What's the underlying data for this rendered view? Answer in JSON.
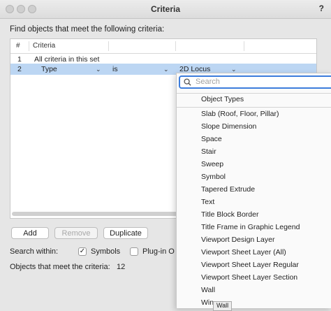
{
  "window": {
    "title": "Criteria",
    "help": "?"
  },
  "prompt": "Find objects that meet the following criteria:",
  "table": {
    "columns": [
      "#",
      "Criteria"
    ],
    "rows": [
      {
        "num": "1",
        "criteria": "All criteria in this set"
      },
      {
        "num": "2",
        "field": "Type",
        "operator": "is",
        "value": "2D Locus"
      }
    ]
  },
  "buttons": {
    "add": "Add",
    "remove": "Remove",
    "duplicate": "Duplicate"
  },
  "search_within": {
    "label": "Search within:",
    "symbols": "Symbols",
    "plugin": "Plug-in O"
  },
  "objects_count": {
    "label": "Objects that meet the criteria:",
    "value": "12"
  },
  "dropdown": {
    "search_placeholder": "Search",
    "header": "Object Types",
    "options": [
      "Slab (Roof, Floor, Pillar)",
      "Slope Dimension",
      "Space",
      "Stair",
      "Sweep",
      "Symbol",
      "Tapered Extrude",
      "Text",
      "Title Block Border",
      "Title Frame in Graphic Legend",
      "Viewport   Design Layer",
      "Viewport   Sheet Layer (All)",
      "Viewport   Sheet Layer Regular",
      "Viewport   Sheet Layer Section",
      "Wall",
      "Win"
    ],
    "tooltip": "Wall"
  }
}
